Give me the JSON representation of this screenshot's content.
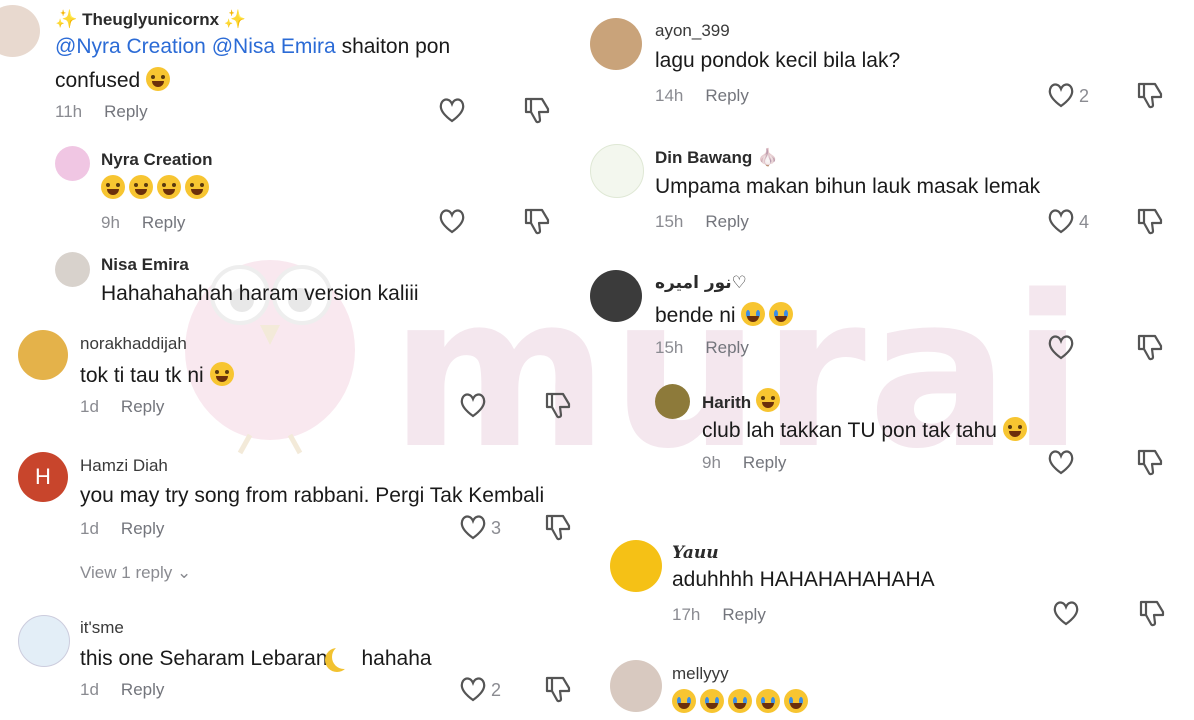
{
  "watermark": "murai",
  "left": [
    {
      "id": "c1",
      "user": "Theuglyunicornx",
      "mentions": [
        "@Nyra Creation",
        "@Nisa Emira"
      ],
      "text1": "shaiton pon",
      "text2": "confused",
      "time": "11h",
      "reply": "Reply"
    },
    {
      "id": "c2",
      "user": "Nyra Creation",
      "time": "9h",
      "reply": "Reply"
    },
    {
      "id": "c3",
      "user": "Nisa Emira",
      "text": "Hahahahahah haram version kaliii"
    },
    {
      "id": "c4",
      "user": "norakhaddijah",
      "text": "tok ti tau tk ni",
      "time": "1d",
      "reply": "Reply"
    },
    {
      "id": "c5",
      "user": "Hamzi Diah",
      "avatar_letter": "H",
      "text": "you may try song from rabbani. Pergi Tak Kembali",
      "time": "1d",
      "reply": "Reply",
      "likes": "3",
      "view_replies": "View 1 reply"
    },
    {
      "id": "c6",
      "user": "it'sme",
      "text_a": "this one Seharam Lebaran",
      "text_b": "hahaha",
      "time": "1d",
      "reply": "Reply",
      "likes": "2"
    }
  ],
  "right": [
    {
      "id": "r1",
      "user": "ayon_399",
      "text": "lagu pondok kecil bila lak?",
      "time": "14h",
      "reply": "Reply",
      "likes": "2"
    },
    {
      "id": "r2",
      "user": "Din Bawang",
      "text": "Umpama makan bihun lauk masak lemak",
      "time": "15h",
      "reply": "Reply",
      "likes": "4"
    },
    {
      "id": "r3",
      "user": "نور اميره♡",
      "text": "bende ni",
      "time": "15h",
      "reply": "Reply"
    },
    {
      "id": "r4",
      "user": "Harith",
      "text": "club lah takkan TU pon tak tahu",
      "time": "9h",
      "reply": "Reply"
    },
    {
      "id": "r5",
      "user": "Yauu",
      "text": "aduhhhh HAHAHAHAHAHA",
      "time": "17h",
      "reply": "Reply"
    },
    {
      "id": "r6",
      "user": "mellyyy"
    }
  ],
  "icons": {
    "like": "heart-outline-icon",
    "dislike": "thumbs-down-outline-icon"
  },
  "colors": {
    "mention": "#2b6bd6",
    "meta": "#8a8b91",
    "watermark": "#f4e7ee",
    "avatar_h": "#c8452c"
  }
}
